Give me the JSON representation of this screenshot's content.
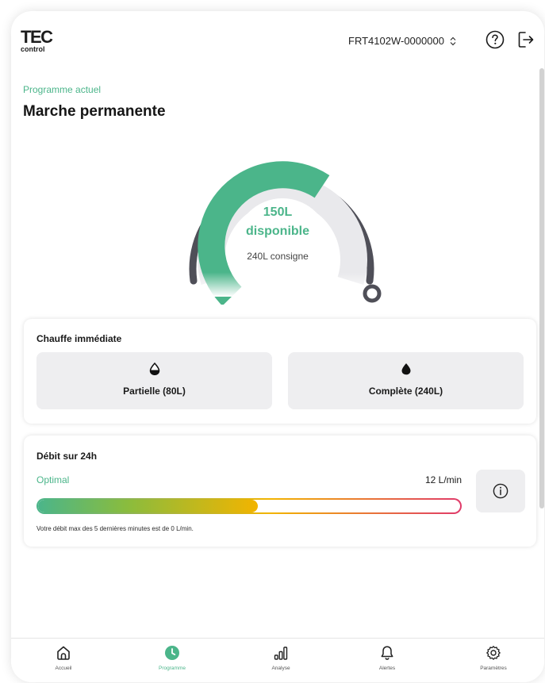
{
  "header": {
    "logo_top": "TEC",
    "logo_bottom": "control",
    "device_id": "FRT4102W-0000000",
    "help_icon": "help-circle-icon",
    "logout_icon": "logout-icon"
  },
  "program": {
    "label": "Programme actuel",
    "title": "Marche permanente"
  },
  "gauge": {
    "available_value": "150L",
    "available_label": "disponible",
    "target": "240L consigne",
    "available_liters": 150,
    "target_liters": 240,
    "colors": {
      "fill": "#4bb58a",
      "track": "#e9e9ec",
      "outer": "#4f4f58"
    }
  },
  "chauffe": {
    "title": "Chauffe immédiate",
    "partial_label": "Partielle (80L)",
    "partial_icon": "half-drop-icon",
    "full_label": "Complète (240L)",
    "full_icon": "drop-icon"
  },
  "debit": {
    "title": "Débit sur 24h",
    "status": "Optimal",
    "rate": "12 L/min",
    "fill_fraction": 0.52,
    "note": "Votre débit max des 5 dernières minutes est de 0 L/min.",
    "info_icon": "info-icon"
  },
  "nav": {
    "items": [
      {
        "label": "Accueil",
        "icon": "home-icon"
      },
      {
        "label": "Programme",
        "icon": "clock-icon",
        "active": true
      },
      {
        "label": "Analyse",
        "icon": "bar-chart-icon"
      },
      {
        "label": "Alertes",
        "icon": "bell-icon"
      },
      {
        "label": "Paramètres",
        "icon": "gear-icon"
      }
    ]
  },
  "colors": {
    "accent": "#4bb58a",
    "text": "#1a1a1a",
    "button_bg": "#eeeef0"
  }
}
